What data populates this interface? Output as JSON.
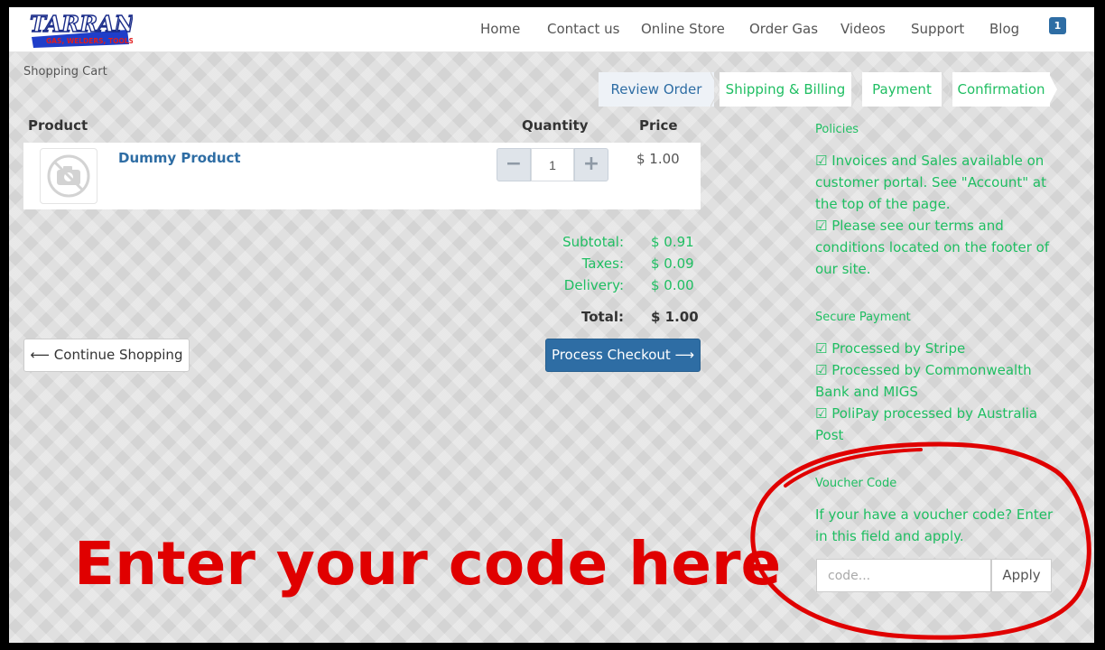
{
  "logo": {
    "main": "TARRANTS",
    "sub": "GAS, WELDERS, TOOLS"
  },
  "nav": [
    "Home",
    "Contact us",
    "Online Store",
    "Order Gas",
    "Videos",
    "Support",
    "Blog"
  ],
  "cart_count": "1",
  "breadcrumb": "Shopping Cart",
  "steps": [
    "Review Order",
    "Shipping & Billing",
    "Payment",
    "Confirmation"
  ],
  "colors": {
    "accent_blue": "#2e6da4",
    "green": "#1fbe62",
    "annotation_red": "#e00000"
  },
  "table": {
    "headers": {
      "product": "Product",
      "quantity": "Quantity",
      "price": "Price"
    },
    "rows": [
      {
        "name": "Dummy Product",
        "qty": "1",
        "price": "$ 1.00",
        "image_icon": "no-camera-icon"
      }
    ]
  },
  "summary": {
    "subtotal_label": "Subtotal:",
    "subtotal": "$ 0.91",
    "taxes_label": "Taxes:",
    "taxes": "$ 0.09",
    "delivery_label": "Delivery:",
    "delivery": "$ 0.00",
    "total_label": "Total:",
    "total": "$ 1.00"
  },
  "buttons": {
    "continue": "⟵ Continue Shopping",
    "checkout": "Process Checkout ⟶"
  },
  "sidebar": {
    "policies_title": "Policies",
    "policies_text": "☑ Invoices and Sales available on customer portal. See \"Account\" at the top of the page.\n☑ Please see our terms and conditions located on the footer of our site.",
    "secure_title": "Secure Payment",
    "secure_text": " ☑ Processed by Stripe\n ☑ Processed by Commonwealth Bank and MIGS\n ☑ PoliPay processed by Australia Post",
    "voucher_title": "Voucher Code",
    "voucher_text": "If your have a voucher code? Enter in this field and apply.",
    "voucher_placeholder": "code...",
    "apply": "Apply"
  },
  "annotation": "Enter your code here"
}
